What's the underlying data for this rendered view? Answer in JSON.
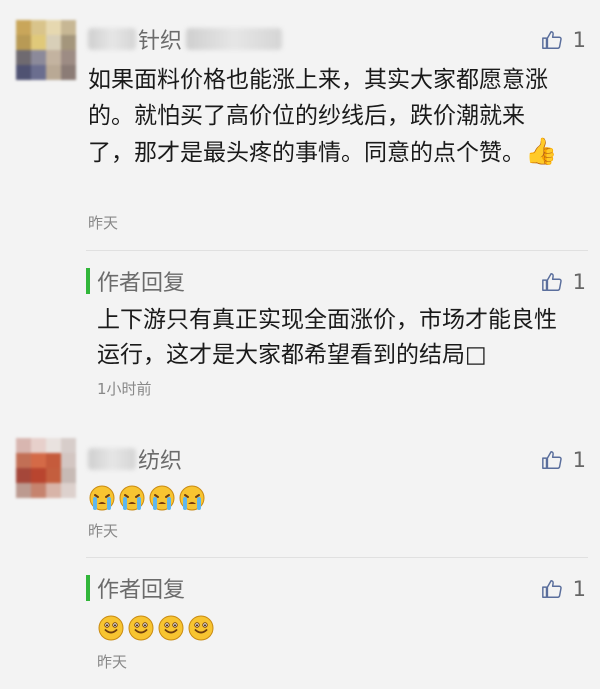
{
  "comments": [
    {
      "name_suffix": "针织",
      "like_count": "1",
      "text": "如果面料价格也能涨上来，其实大家都愿意涨的。就怕买了高价位的纱线后，跌价潮就来了，那才是最头疼的事情。同意的点个赞。",
      "thumbs_emoji": "👍",
      "time": "昨天",
      "reply": {
        "title": "作者回复",
        "like_count": "1",
        "text": "上下游只有真正实现全面涨价，市场才能良性运行，这才是大家都希望看到的结局□",
        "time": "1小时前"
      }
    },
    {
      "name_suffix": "纺织",
      "like_count": "1",
      "emojis": [
        "crying-face",
        "crying-face",
        "crying-face",
        "crying-face"
      ],
      "time": "昨天",
      "reply": {
        "title": "作者回复",
        "like_count": "1",
        "emojis": [
          "smiling-face",
          "smiling-face",
          "smiling-face",
          "smiling-face"
        ],
        "time": "昨天"
      }
    }
  ],
  "colors": {
    "background": "#f3f3f3",
    "reply_bar": "#31b63a",
    "meta_text": "#888888"
  }
}
